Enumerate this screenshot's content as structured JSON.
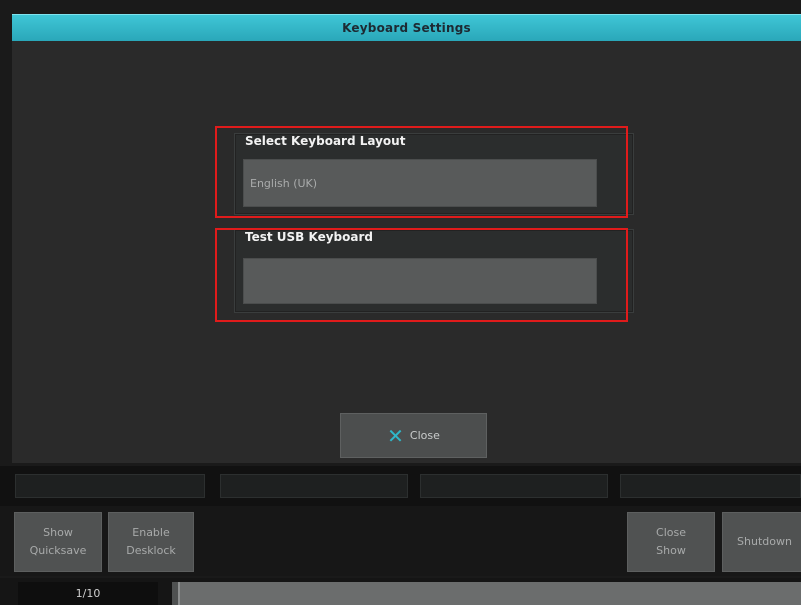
{
  "window": {
    "title": "Keyboard Settings"
  },
  "keyboard_layout": {
    "label": "Select Keyboard Layout",
    "value": "English (UK)"
  },
  "test_keyboard": {
    "label": "Test USB Keyboard",
    "value": ""
  },
  "dialog": {
    "close_label": "Close",
    "close_icon": "close-x-icon"
  },
  "soft_buttons": {
    "show_quicksave": {
      "line1": "Show",
      "line2": "Quicksave"
    },
    "enable_desklock": {
      "line1": "Enable",
      "line2": "Desklock"
    },
    "close_show": {
      "line1": "Close",
      "line2": "Show"
    },
    "shutdown": {
      "line1": "Shutdown"
    }
  },
  "status": {
    "page": "1/10",
    "progress": 0.01
  },
  "colors": {
    "accent": "#2fb7c9",
    "highlight": "#e01b1b"
  }
}
